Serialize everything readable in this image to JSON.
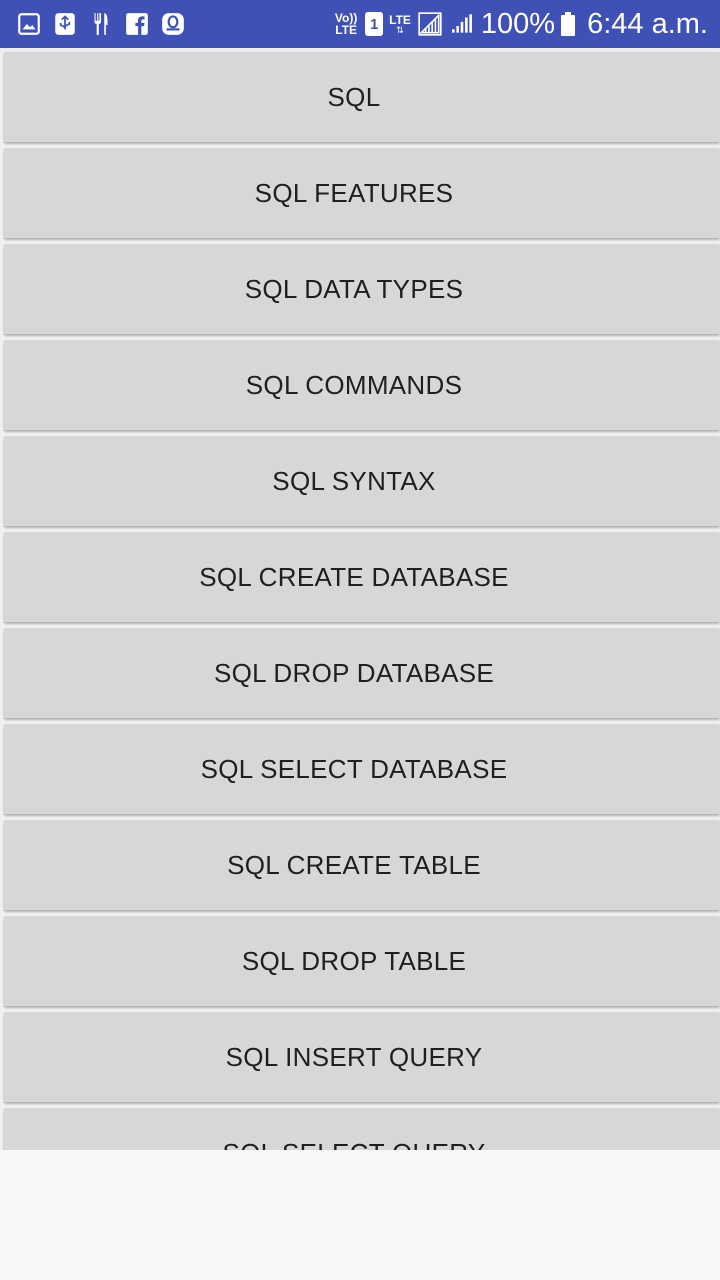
{
  "status_bar": {
    "notification_icons": [
      "image-icon",
      "usb-icon",
      "restaurant-icon",
      "facebook-icon",
      "opera-icon"
    ],
    "volte_label": "Vo))\nLTE",
    "sim_slot": "1",
    "lte_label": "LTE",
    "battery_percent": "100%",
    "time": "6:44 a.m.",
    "background_color": "#3f51b5"
  },
  "menu": {
    "items": [
      {
        "label": "SQL"
      },
      {
        "label": "SQL FEATURES"
      },
      {
        "label": "SQL DATA TYPES"
      },
      {
        "label": "SQL COMMANDS"
      },
      {
        "label": "SQL SYNTAX"
      },
      {
        "label": "SQL CREATE DATABASE"
      },
      {
        "label": "SQL DROP DATABASE"
      },
      {
        "label": "SQL SELECT DATABASE"
      },
      {
        "label": "SQL CREATE TABLE"
      },
      {
        "label": "SQL DROP TABLE"
      },
      {
        "label": "SQL INSERT QUERY"
      },
      {
        "label": "SQL SELECT QUERY"
      }
    ],
    "button_color": "#d7d7d7"
  }
}
